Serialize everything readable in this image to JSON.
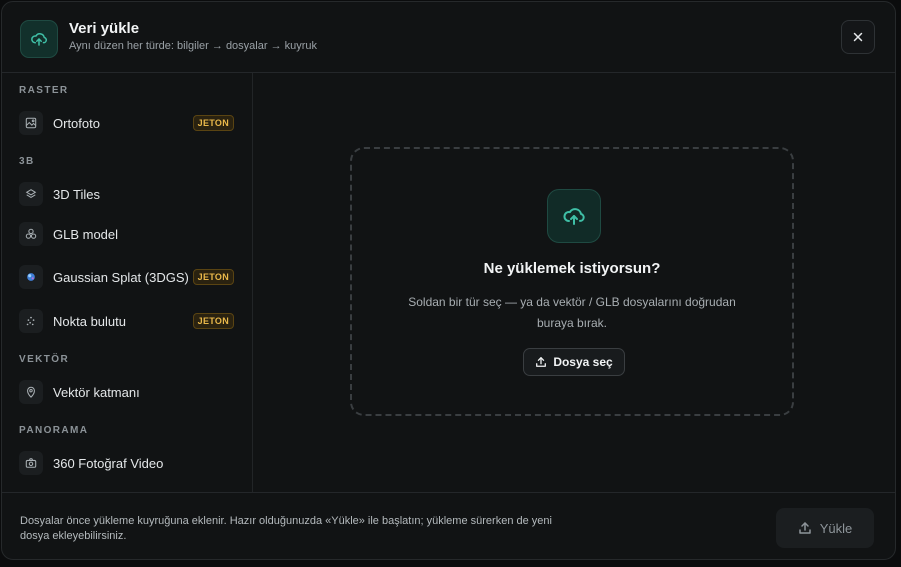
{
  "header": {
    "title": "Veri yükle",
    "subtitle": "Aynı düzen her türde: bilgiler → dosyalar → kuyruk",
    "icon": "cloud-upload-icon",
    "close_icon": "close-icon"
  },
  "sidebar": {
    "sections": [
      {
        "title": "RASTER",
        "items": [
          {
            "label": "Ortofoto",
            "icon": "image-icon",
            "badge": "JETON"
          }
        ]
      },
      {
        "title": "3B",
        "items": [
          {
            "label": "3D Tiles",
            "icon": "layers-icon",
            "badge": ""
          },
          {
            "label": "GLB model",
            "icon": "molecule-icon",
            "badge": ""
          },
          {
            "label": "Gaussian Splat (3DGS)",
            "icon": "splat-icon",
            "badge": "JETON"
          },
          {
            "label": "Nokta bulutu",
            "icon": "point-cloud-icon",
            "badge": "JETON"
          }
        ]
      },
      {
        "title": "VEKTÖR",
        "items": [
          {
            "label": "Vektör katmanı",
            "icon": "map-pin-icon",
            "badge": ""
          }
        ]
      },
      {
        "title": "PANORAMA",
        "items": [
          {
            "label": "360 Fotoğraf Video",
            "icon": "camera-icon",
            "badge": ""
          }
        ]
      }
    ]
  },
  "dropzone": {
    "icon": "cloud-upload-icon",
    "title": "Ne yüklemek istiyorsun?",
    "text": "Soldan bir tür seç — ya da vektör / GLB dosyalarını doğrudan buraya bırak.",
    "button_label": "Dosya seç",
    "button_icon": "upload-icon"
  },
  "footer": {
    "note": "Dosyalar önce yükleme kuyruğuna eklenir. Hazır olduğunuzda «Yükle» ile başlatın; yükleme sürerken de yeni dosya ekleyebilirsiniz.",
    "upload_label": "Yükle",
    "upload_icon": "upload-icon"
  },
  "colors": {
    "accent": "#3fbfa6",
    "badge": "#e9b84a"
  }
}
